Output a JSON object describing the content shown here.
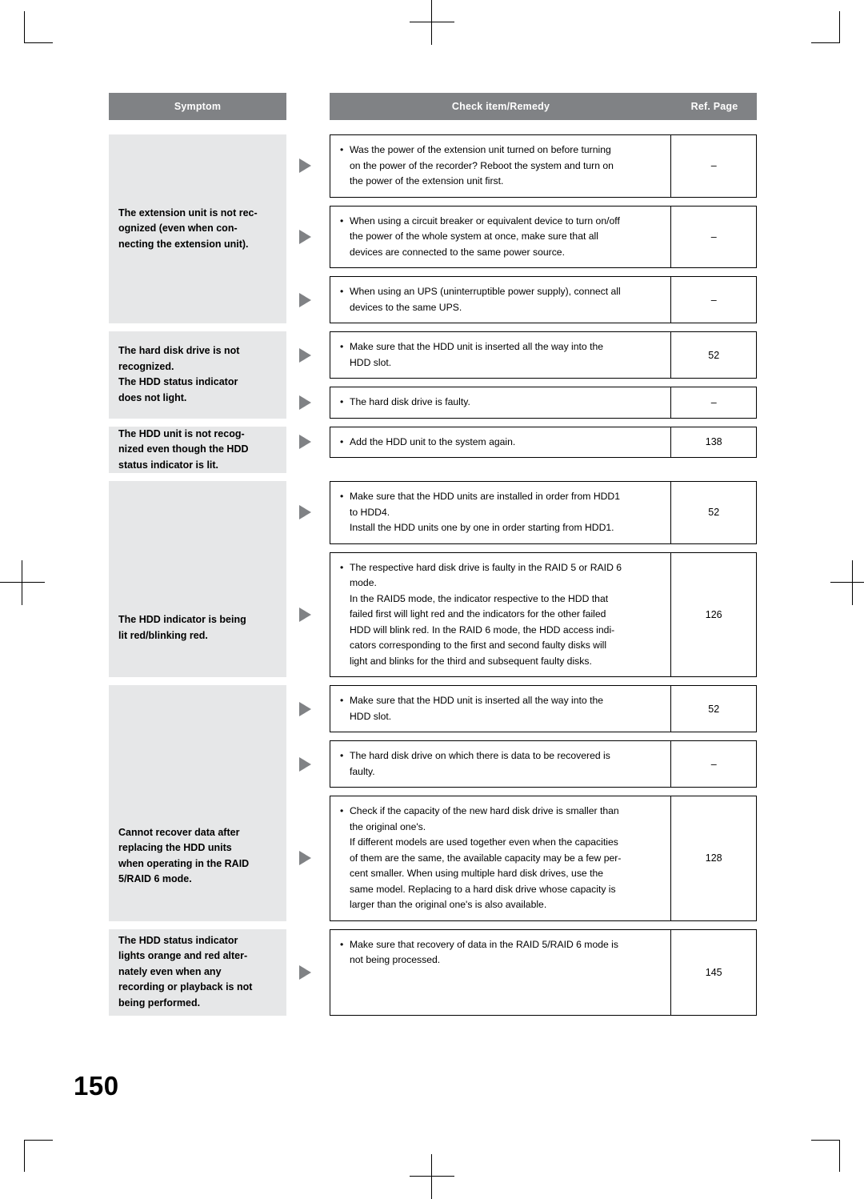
{
  "page": {
    "number": "150"
  },
  "table": {
    "headers": {
      "symptom": "Symptom",
      "check": "Check item/Remedy",
      "ref": "Ref. Page"
    },
    "groups": [
      {
        "symptom": "The extension unit is not rec-\nognized (even when con-\nnecting the extension unit).",
        "rows": [
          {
            "lines": [
              "Was the power of the extension unit turned on before turning",
              "on the power of the recorder? Reboot the system and turn on",
              "the power of the extension unit first."
            ],
            "ref": "–"
          },
          {
            "lines": [
              "When using a circuit breaker or equivalent device to turn on/off",
              "the power of the whole system at once, make sure that all",
              "devices are connected to the same power source."
            ],
            "ref": "–"
          },
          {
            "lines": [
              "When using an UPS (uninterruptible power supply), connect all",
              "devices to the same UPS."
            ],
            "ref": "–"
          }
        ]
      },
      {
        "symptom": "The hard disk drive is not\nrecognized.\nThe HDD status indicator\ndoes not light.",
        "rows": [
          {
            "lines": [
              "Make sure that the HDD unit is inserted all the way into the",
              "HDD slot."
            ],
            "ref": "52"
          },
          {
            "lines": [
              "The hard disk drive is faulty."
            ],
            "ref": "–"
          }
        ]
      },
      {
        "symptom": "The HDD unit is not recog-\nnized even though the HDD\nstatus indicator is lit.",
        "rows": [
          {
            "lines": [
              "Add the HDD unit to the system again."
            ],
            "ref": "138"
          }
        ]
      },
      {
        "symptom": "The HDD indicator is being\nlit red/blinking red.",
        "rows": [
          {
            "lines": [
              "Make sure that the HDD units are installed in order from HDD1",
              "to HDD4."
            ],
            "plain": [
              "Install the HDD units one by one in order starting from HDD1."
            ],
            "ref": "52"
          },
          {
            "lines": [
              "The respective hard disk drive is faulty in the RAID 5 or RAID 6",
              "mode."
            ],
            "plain": [
              "In the RAID5 mode, the indicator respective to the HDD that",
              "failed first will light red and the indicators for the other failed",
              "HDD will blink red. In the RAID 6 mode, the HDD access indi-",
              "cators corresponding to the first and second faulty disks will",
              "light and blinks for the third and subsequent faulty disks."
            ],
            "ref": "126"
          }
        ]
      },
      {
        "symptom": "Cannot recover data after\nreplacing the HDD units\nwhen operating in the RAID\n5/RAID 6 mode.",
        "rows": [
          {
            "lines": [
              "Make sure that the HDD unit is inserted all the way into the",
              "HDD slot."
            ],
            "ref": "52"
          },
          {
            "lines": [
              "The hard disk drive on which there is data to be recovered is",
              "faulty."
            ],
            "ref": "–"
          },
          {
            "lines": [
              "Check if the capacity of the new hard disk drive is smaller than",
              "the original one's."
            ],
            "plain": [
              "If different models are used together even when the capacities",
              "of them are the same, the available capacity may be a few per-",
              "cent smaller. When using multiple hard disk drives, use the",
              "same model. Replacing to a hard disk drive whose capacity is",
              "larger than the original one's is also available."
            ],
            "ref": "128"
          }
        ]
      },
      {
        "symptom": "The HDD status indicator\nlights orange and red alter-\nnately even when any\nrecording or playback is not\nbeing performed.",
        "rows": [
          {
            "lines": [
              "Make sure that recovery of data in the RAID 5/RAID 6 mode is",
              "not being processed."
            ],
            "ref": "145"
          }
        ]
      }
    ]
  }
}
